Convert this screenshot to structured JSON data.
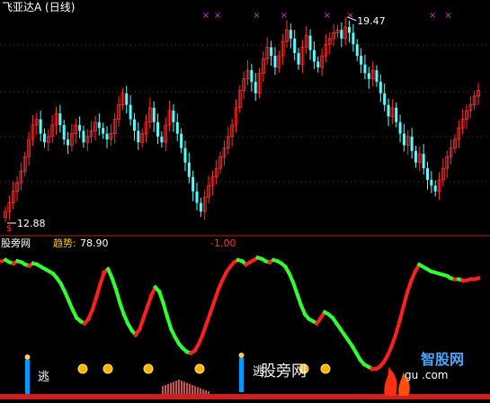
{
  "window": {
    "title": "飞亚达A (日线)"
  },
  "price_panel": {
    "high_label": "19.47",
    "low_label": "12.88",
    "marker_text": "$",
    "signal_glyph": "×",
    "colors": {
      "up": "#ff3030",
      "down": "#55ffff",
      "grid": "#8a2020",
      "signal": "#cc33cc",
      "annotation": "#ffffff"
    }
  },
  "indicator_panel": {
    "name": "股旁网",
    "label": "趋势:",
    "value": "78.90",
    "neg_value": "-1.00",
    "escape_text": "逃",
    "colors": {
      "rise": "#ff2020",
      "fall": "#33ff33",
      "bar": "#ff6666",
      "coin": "#ffb400",
      "blue_bar": "#0099ff"
    }
  },
  "watermarks": {
    "left_text": "股旁网",
    "right_text": "智股网",
    "url_text": "gu  .com"
  },
  "chart_data": [
    {
      "type": "candlestick",
      "title": "飞亚达A (日线)",
      "annotations": [
        {
          "text": "19.47",
          "point": "high"
        },
        {
          "text": "12.88",
          "point": "low"
        }
      ],
      "closes": [
        12.9,
        13.2,
        13.6,
        13.9,
        14.3,
        14.8,
        15.4,
        15.9,
        16.1,
        15.6,
        15.3,
        15.5,
        15.9,
        16.3,
        15.9,
        15.4,
        15.2,
        15.6,
        15.9,
        15.7,
        15.3,
        15.5,
        15.7,
        16.0,
        15.8,
        15.6,
        15.4,
        15.6,
        16.1,
        16.6,
        17.0,
        16.6,
        16.1,
        15.7,
        15.3,
        15.6,
        16.0,
        16.5,
        16.0,
        15.5,
        15.3,
        15.9,
        16.4,
        16.0,
        15.6,
        15.1,
        14.6,
        14.1,
        13.6,
        13.2,
        12.9,
        13.4,
        13.8,
        14.1,
        14.4,
        14.8,
        15.1,
        15.5,
        15.9,
        16.5,
        17.1,
        17.5,
        17.8,
        17.4,
        17.0,
        17.7,
        18.2,
        18.6,
        18.3,
        17.9,
        18.3,
        18.8,
        19.2,
        18.9,
        18.4,
        18.0,
        18.6,
        19.0,
        18.5,
        18.1,
        17.9,
        18.3,
        18.7,
        18.9,
        19.1,
        19.2,
        18.9,
        19.3,
        19.1,
        18.7,
        18.3,
        18.0,
        17.7,
        17.5,
        17.8,
        17.4,
        17.0,
        16.6,
        16.2,
        16.5,
        16.0,
        15.6,
        15.2,
        15.5,
        15.0,
        14.6,
        14.9,
        14.4,
        14.0,
        13.8,
        13.6,
        14.0,
        14.4,
        14.8,
        15.1,
        15.4,
        15.8,
        16.1,
        16.4,
        16.6,
        16.9,
        17.1
      ],
      "signal_positions": [
        51,
        54,
        64,
        71,
        82,
        88,
        109,
        113,
        129,
        137,
        143,
        166,
        179,
        185,
        190,
        197,
        232
      ]
    },
    {
      "type": "line",
      "name": "趋势",
      "last_value": 78.9,
      "values": [
        95,
        96,
        94,
        93,
        95,
        94,
        92,
        91,
        93,
        92,
        90,
        88,
        86,
        84,
        80,
        75,
        68,
        60,
        52,
        45,
        42,
        40,
        44,
        52,
        63,
        75,
        85,
        88,
        80,
        70,
        58,
        48,
        40,
        34,
        30,
        35,
        45,
        55,
        65,
        72,
        68,
        58,
        46,
        35,
        28,
        22,
        18,
        15,
        14,
        16,
        22,
        30,
        40,
        50,
        60,
        70,
        78,
        85,
        90,
        94,
        96,
        95,
        92,
        94,
        96,
        98,
        97,
        95,
        94,
        96,
        95,
        93,
        90,
        84,
        76,
        66,
        56,
        48,
        44,
        42,
        40,
        45,
        50,
        48,
        45,
        40,
        35,
        30,
        25,
        20,
        14,
        8,
        4,
        2,
        0,
        0,
        2,
        6,
        12,
        20,
        30,
        42,
        55,
        68,
        78,
        86,
        92,
        90,
        88,
        86,
        85,
        84,
        83,
        82,
        80,
        79,
        79,
        78,
        78,
        79,
        79,
        80
      ]
    }
  ]
}
